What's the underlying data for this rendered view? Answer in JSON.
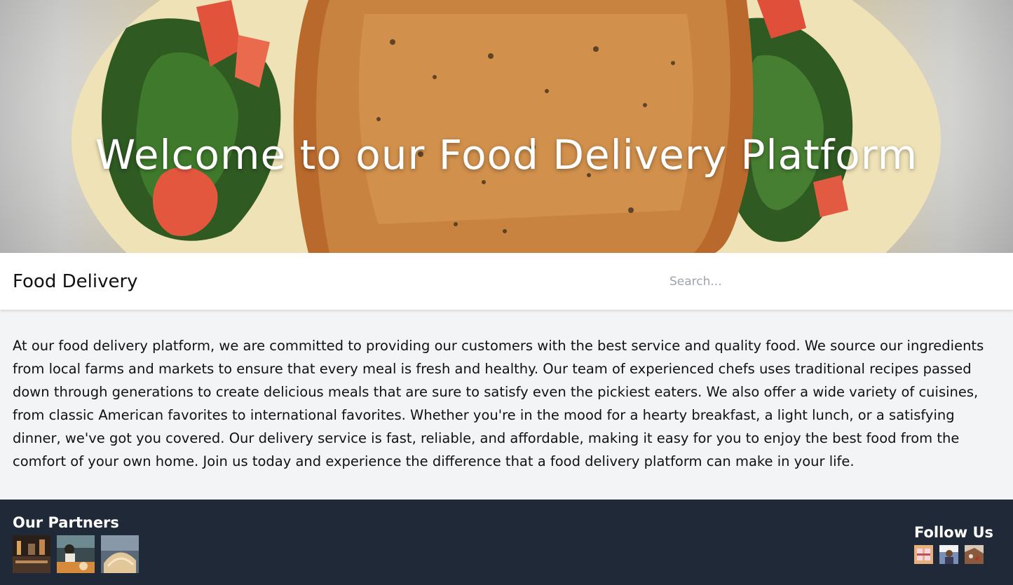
{
  "hero": {
    "title": "Welcome to our Food Delivery Platform"
  },
  "header": {
    "brand": "Food Delivery",
    "search_placeholder": "Search..."
  },
  "main": {
    "about": "At our food delivery platform, we are committed to providing our customers with the best service and quality food. We source our ingredients from local farms and markets to ensure that every meal is fresh and healthy. Our team of experienced chefs uses traditional recipes passed down through generations to create delicious meals that are sure to satisfy even the pickiest eaters. We also offer a wide variety of cuisines, from classic American favorites to international favorites. Whether you're in the mood for a hearty breakfast, a light lunch, or a satisfying dinner, we've got you covered. Our delivery service is fast, reliable, and affordable, making it easy for you to enjoy the best food from the comfort of your own home. Join us today and experience the difference that a food delivery platform can make in your life."
  },
  "footer": {
    "partners_heading": "Our Partners",
    "follow_heading": "Follow Us"
  },
  "colors": {
    "footer_bg": "#1f2937",
    "page_bg": "#f3f4f6",
    "navbar_bg": "#ffffff"
  },
  "icons": {
    "partner_logos": [
      "restaurant-photo-1",
      "restaurant-photo-2",
      "restaurant-photo-3"
    ],
    "social_icons": [
      "social-photo-1",
      "social-photo-2",
      "social-photo-3"
    ]
  }
}
